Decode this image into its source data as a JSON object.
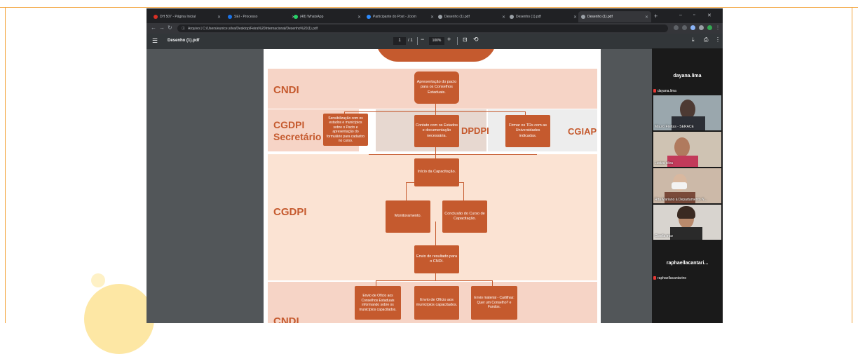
{
  "browser": {
    "tabs": [
      {
        "label": "DH 507 - Página Inicial"
      },
      {
        "label": "SEI - Processo"
      },
      {
        "label": "(48) WhatsApp"
      },
      {
        "label": "Participante do Post - Zoom"
      },
      {
        "label": "Desenho (1).pdf"
      },
      {
        "label": "Desenho (1).pdf"
      },
      {
        "label": "Desenho (1).pdf"
      }
    ],
    "address": "Arquivo  |  C:/Users/eunice.silva/Desktop/Feira%20Internacional/Desenho%20(1).pdf"
  },
  "pdf": {
    "title": "Desenho (1).pdf",
    "page_current": "1",
    "page_total": "/ 1",
    "zoom": "100%"
  },
  "diagram": {
    "sections": {
      "cndi": "CNDI",
      "cgdpi_sec_line1": "CGDPI",
      "cgdpi_sec_line2": "Secretário",
      "dpdpi": "DPDPI",
      "cgiap": "CGIAP",
      "cgdpi": "CGDPI",
      "bottom": "CNDI"
    },
    "boxes": {
      "apresentacao": "Apresentação do pacto para os Conselhos Estaduais.",
      "sensibilizacao": "Sensibilização com os estados e municípios sobre o Pacto e apresentação do formulário para cadastro no curso.",
      "contato": "Contato com os Estados e documentação necessária.",
      "firmar": "Firmar os TRs com as Universidades indicadas.",
      "inicio": "Início da Capacitação.",
      "monitoramento": "Monitoramento.",
      "conclusao": "Conclusão do Curso de Capacitação.",
      "envio_resultado": "Envio do resultado para o CNDI.",
      "oficio_conselhos": "Envio de Ofício aos Conselhos Estaduais informando sobre os municípios capacitados.",
      "oficio_municipios": "Envio de Ofício aos municípios capacitados.",
      "material": "Envio material - Cartilhas: Quer um Conselho? e Fundos."
    }
  },
  "participants": {
    "tiles": [
      {
        "display_name": "dayana.lima",
        "label": "dayana.lima"
      },
      {
        "label": "Mauro Freitas - SERACE"
      },
      {
        "label": "Luciza silva"
      },
      {
        "label": "Rita Mariano à Departamento N..."
      },
      {
        "label": "Gisella moz"
      },
      {
        "display_name": "raphaellacantari...",
        "label": "raphaellacantarino"
      }
    ]
  },
  "colors": {
    "accent": "#c55a2e",
    "band": "#f6d4c6",
    "frame": "#f2a33a"
  }
}
